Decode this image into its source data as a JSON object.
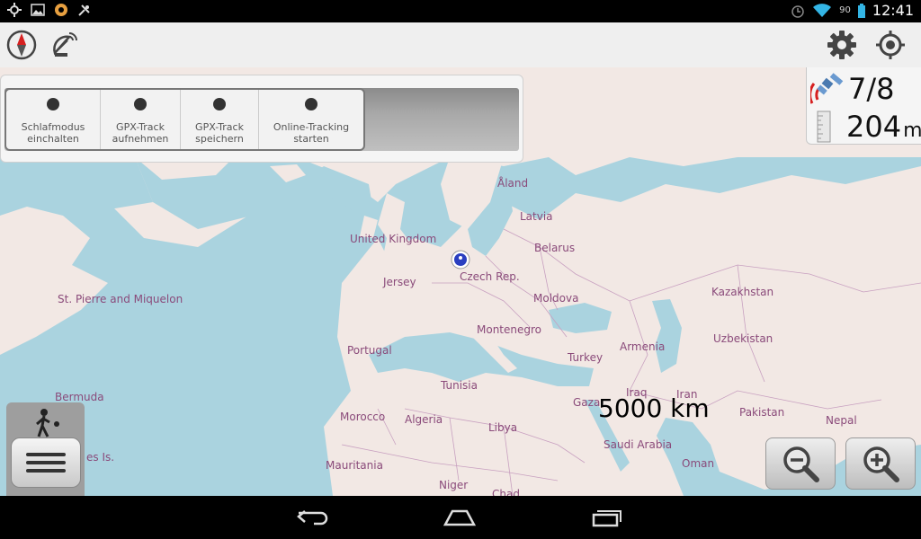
{
  "status_bar": {
    "battery": "90",
    "time": "12:41"
  },
  "popup_menu": {
    "items": [
      {
        "label_line1": "Schlafmodus",
        "label_line2": "einchalten"
      },
      {
        "label_line1": "GPX-Track",
        "label_line2": "aufnehmen"
      },
      {
        "label_line1": "GPX-Track",
        "label_line2": "speichern"
      },
      {
        "label_line1": "Online-Tracking",
        "label_line2": "starten"
      }
    ]
  },
  "gps": {
    "satellites": "7/8",
    "altitude": "204",
    "altitude_unit": "m"
  },
  "map": {
    "scale": "5000 km",
    "labels": {
      "aland": "Åland",
      "latvia": "Latvia",
      "uk": "United Kingdom",
      "belarus": "Belarus",
      "jersey": "Jersey",
      "czech": "Czech Rep.",
      "kazakhstan": "Kazakhstan",
      "st_pierre": "St. Pierre and Miquelon",
      "moldova": "Moldova",
      "montenegro": "Montenegro",
      "portugal": "Portugal",
      "armenia": "Armenia",
      "uzbekistan": "Uzbekistan",
      "turkey": "Turkey",
      "tunisia": "Tunisia",
      "iraq": "Iraq",
      "iran": "Iran",
      "bermuda": "Bermuda",
      "gaza": "Gaza",
      "pakistan": "Pakistan",
      "morocco": "Morocco",
      "algeria": "Algeria",
      "libya": "Libya",
      "nepal": "Nepal",
      "saudi": "Saudi Arabia",
      "islands": "es Is.",
      "mauritania": "Mauritania",
      "oman": "Oman",
      "niger": "Niger",
      "chad": "Chad"
    }
  },
  "icons": {
    "compass": "compass-icon",
    "satellite_dish": "satellite-dish-icon",
    "settings": "gear-icon",
    "locate": "crosshair-icon",
    "zoom_out": "zoom-out-icon",
    "zoom_in": "zoom-in-icon",
    "walk": "walking-person-icon",
    "menu": "hamburger-menu-icon"
  },
  "colors": {
    "sea": "#aad3df",
    "land": "#f2e8e4",
    "label": "#8a4a7a"
  }
}
